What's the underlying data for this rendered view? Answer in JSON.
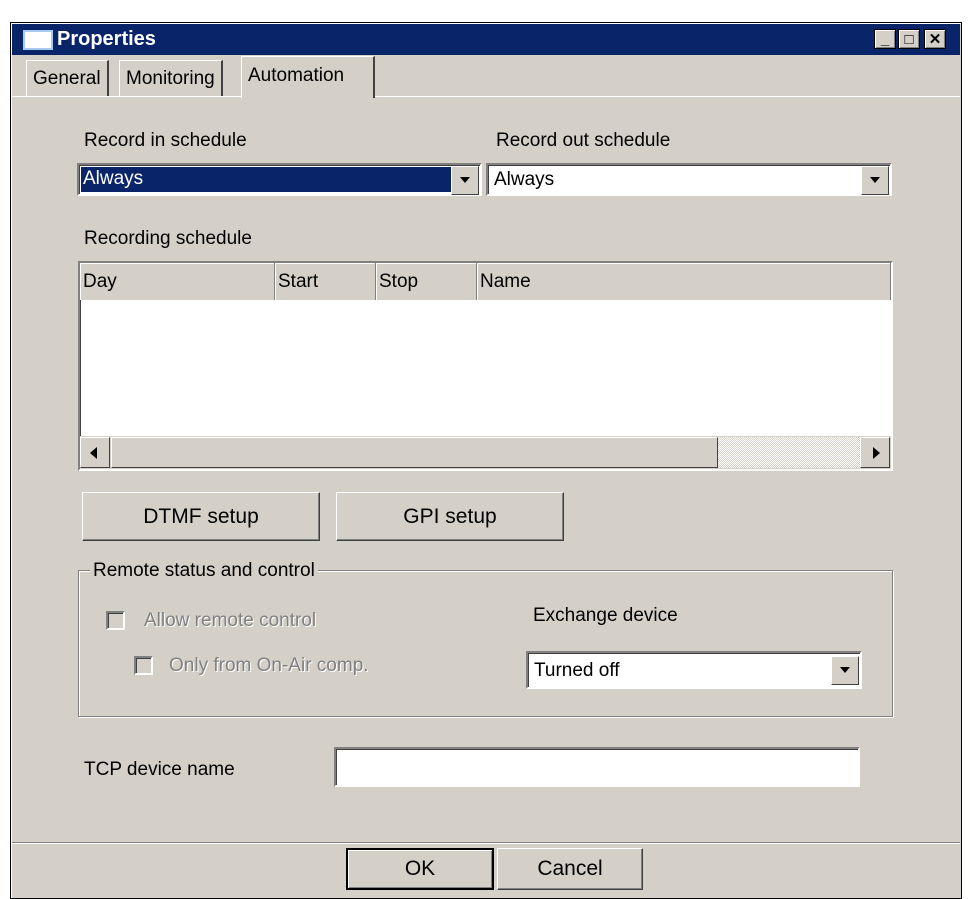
{
  "window": {
    "title": "Properties"
  },
  "title_buttons": {
    "minimize": "_",
    "maximize": "□",
    "close": "✕"
  },
  "tabs": [
    {
      "label": "General"
    },
    {
      "label": "Monitoring"
    },
    {
      "label": "Automation",
      "active": true
    }
  ],
  "record_in": {
    "label": "Record in schedule",
    "value": "Always"
  },
  "record_out": {
    "label": "Record out schedule",
    "value": "Always"
  },
  "recording_schedule": {
    "label": "Recording schedule",
    "columns": [
      "Day",
      "Start",
      "Stop",
      "Name"
    ],
    "rows": []
  },
  "buttons": {
    "dtmf": "DTMF setup",
    "gpi": "GPI setup",
    "ok": "OK",
    "cancel": "Cancel"
  },
  "remote": {
    "group_label": "Remote status and control",
    "allow_remote": {
      "label": "Allow remote control",
      "checked": false,
      "enabled": false
    },
    "only_onair": {
      "label": "Only from On-Air comp.",
      "checked": false,
      "enabled": false
    },
    "exchange_label": "Exchange device",
    "exchange_value": "Turned off"
  },
  "tcp": {
    "label": "TCP device name",
    "value": ""
  },
  "colors": {
    "title_bar": "#0a246a",
    "face": "#d4d0c8",
    "selection": "#0a246a"
  }
}
